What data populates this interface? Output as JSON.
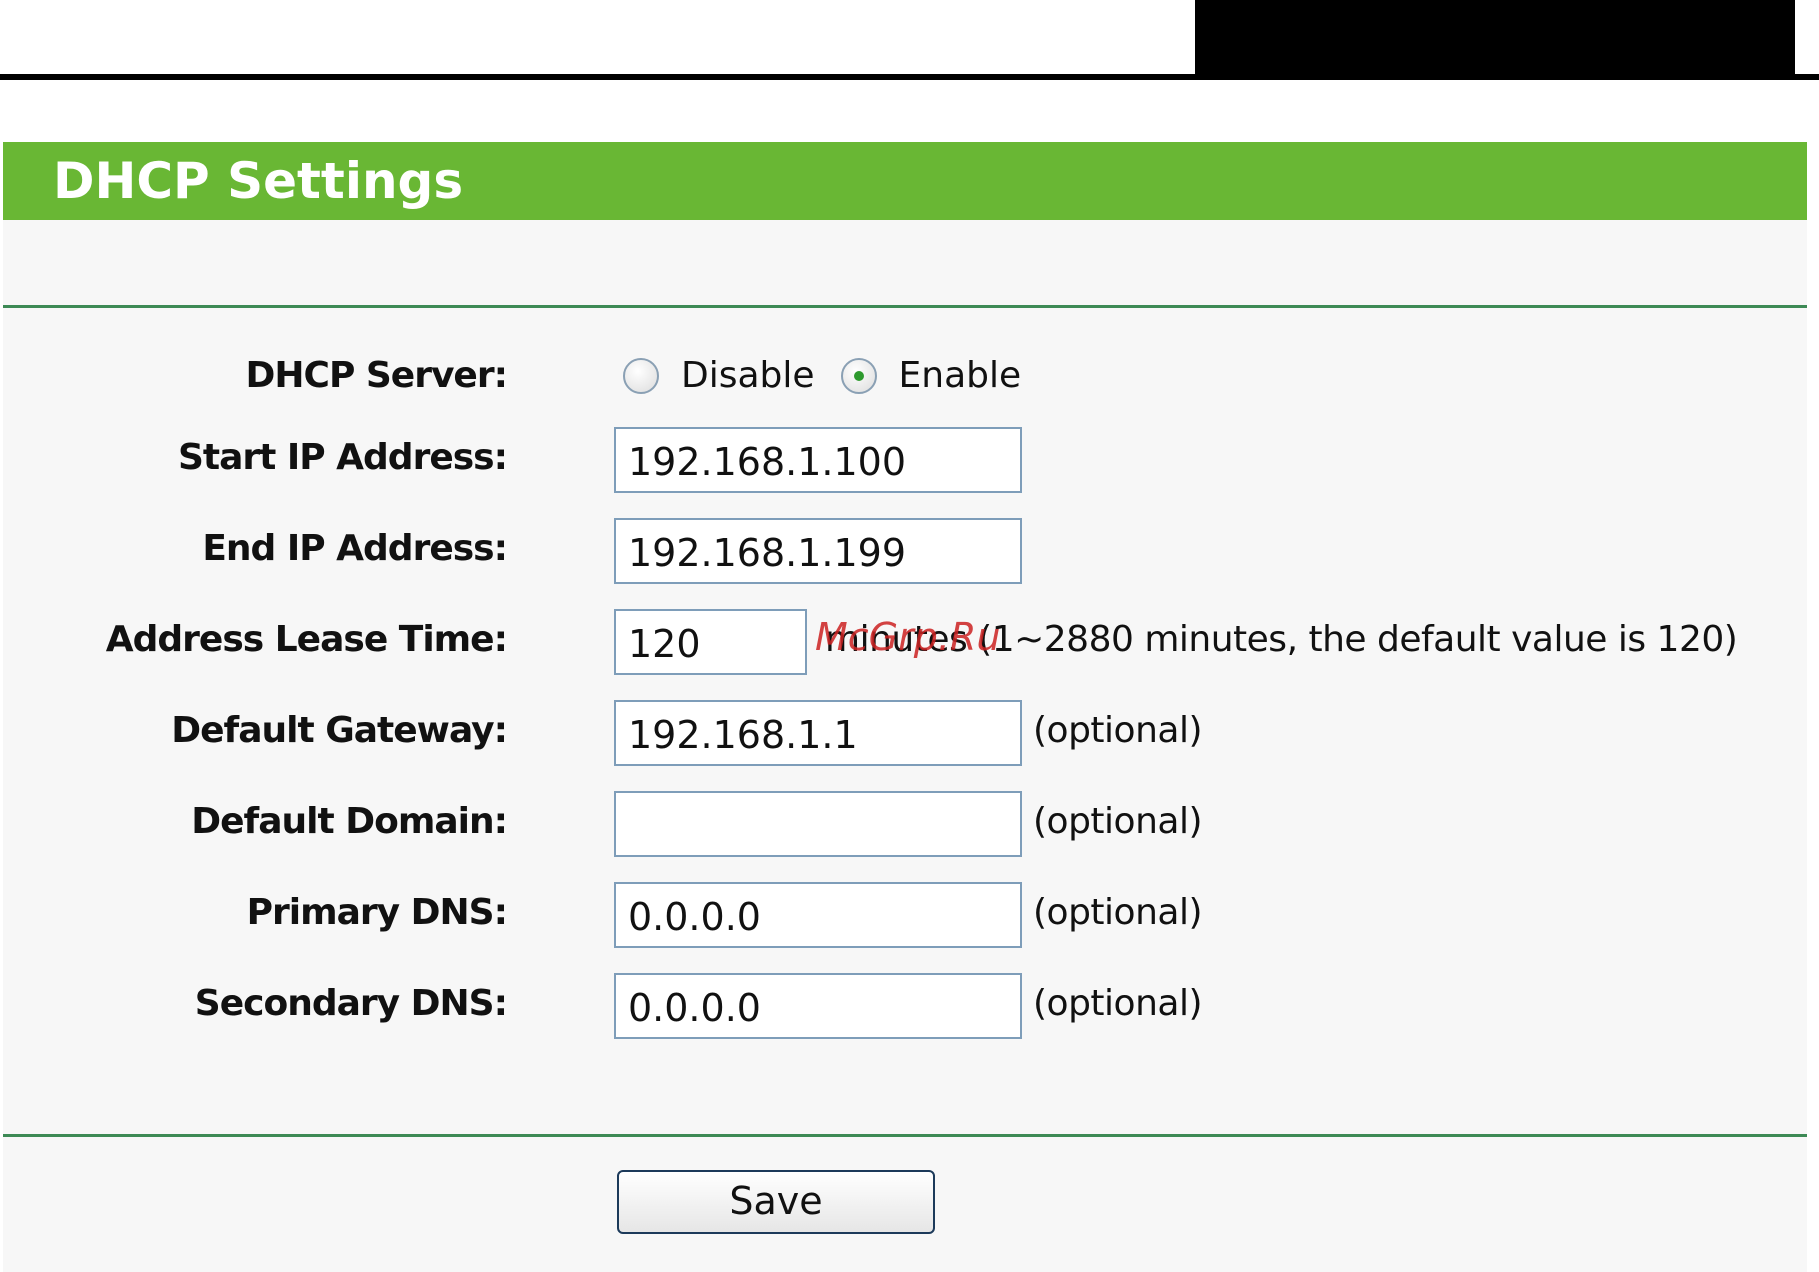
{
  "header": {
    "title": "DHCP Settings"
  },
  "form": {
    "dhcp_server": {
      "label": "DHCP Server:",
      "options": [
        {
          "label": "Disable",
          "checked": false
        },
        {
          "label": "Enable",
          "checked": true
        }
      ]
    },
    "start_ip": {
      "label": "Start IP Address:",
      "value": "192.168.1.100"
    },
    "end_ip": {
      "label": "End IP Address:",
      "value": "192.168.1.199"
    },
    "lease_time": {
      "label": "Address Lease Time:",
      "value": "120",
      "hint": "minutes (1~2880 minutes, the default value is 120)"
    },
    "default_gateway": {
      "label": "Default Gateway:",
      "value": "192.168.1.1",
      "hint": "(optional)"
    },
    "default_domain": {
      "label": "Default Domain:",
      "value": "",
      "hint": "(optional)"
    },
    "primary_dns": {
      "label": "Primary DNS:",
      "value": "0.0.0.0",
      "hint": "(optional)"
    },
    "secondary_dns": {
      "label": "Secondary DNS:",
      "value": "0.0.0.0",
      "hint": "(optional)"
    }
  },
  "actions": {
    "save_label": "Save"
  },
  "watermark": "McGrp.Ru",
  "colors": {
    "header_green": "#69b734",
    "rule_green": "#3d8a55",
    "panel_bg": "#f7f7f7",
    "field_border": "#7e9db9",
    "watermark_red": "#cc2222"
  }
}
